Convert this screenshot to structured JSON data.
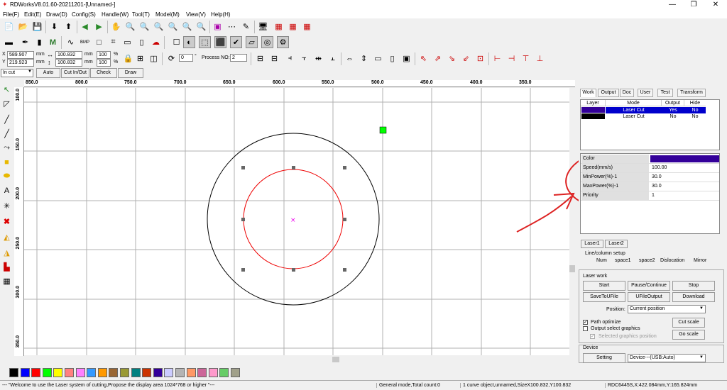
{
  "window": {
    "title": "RDWorksV8.01.60-20211201-[Unnamed-]",
    "minimize": "—",
    "maximize": "❐",
    "close": "✕"
  },
  "menu": [
    "File(F)",
    "Edit(E)",
    "Draw(D)",
    "Config(S)",
    "Handle(W)",
    "Tool(T)",
    "Model(M)",
    "View(V)",
    "Help(H)"
  ],
  "coords": {
    "x_label": "X",
    "y_label": "Y",
    "x_value": "589.907",
    "y_value": "219.923",
    "unit": "mm",
    "w_value": "100.832",
    "h_value": "100.832",
    "w_unit": "mm",
    "h_unit": "mm",
    "scale_w": "100",
    "scale_h": "100",
    "pct": "%",
    "rotate_value": "0",
    "rotate_unit": "°",
    "process_label": "Process NO:",
    "process_value": "2"
  },
  "cut_toolbar": {
    "mode_value": "In cut",
    "auto": "Auto",
    "cut_in_out": "Cut In/Out",
    "check": "Check",
    "draw": "Draw"
  },
  "ruler_top": [
    "850.0",
    "800.0",
    "750.0",
    "700.0",
    "650.0",
    "600.0",
    "550.0",
    "500.0",
    "450.0",
    "400.0",
    "350.0"
  ],
  "ruler_left": [
    "100.0",
    "150.0",
    "200.0",
    "250.0",
    "300.0",
    "350.0"
  ],
  "palette_colors": [
    "#000000",
    "#0000ff",
    "#ff0000",
    "#00ff00",
    "#ffff00",
    "#ff8080",
    "#ff80ff",
    "#3399ff",
    "#ff9900",
    "#996633",
    "#999933",
    "#008080",
    "#cc3300",
    "#330099",
    "#ccccff",
    "#b4b4b4",
    "#ff9966",
    "#cc6699",
    "#ff99cc",
    "#66cc66",
    "#a0a08a"
  ],
  "tabs": [
    "Work",
    "Output",
    "Doc",
    "User",
    "Test",
    "Transform"
  ],
  "layer_table": {
    "headers": [
      "Layer",
      "Mode",
      "Output",
      "Hide"
    ],
    "rows": [
      {
        "color": "#330099",
        "mode": "Laser Cut",
        "output": "Yes",
        "hide": "No",
        "selected": true
      },
      {
        "color": "#000000",
        "mode": "Laser Cut",
        "output": "No",
        "hide": "No",
        "selected": false
      }
    ]
  },
  "properties": [
    {
      "key": "Color",
      "value": ""
    },
    {
      "key": "Speed(mm/s)",
      "value": "100.00"
    },
    {
      "key": "MinPower(%)-1",
      "value": "30.0"
    },
    {
      "key": "MaxPower(%)-1",
      "value": "30.0"
    },
    {
      "key": "Priority",
      "value": "1"
    }
  ],
  "property_color": "#330099",
  "laser_tabs": [
    "Laser1",
    "Laser2"
  ],
  "line_column": {
    "title": "Line/column setup",
    "cols": [
      "Num",
      "space1",
      "space2",
      "Dislocation",
      "Mirror"
    ]
  },
  "laser_work": {
    "title": "Laser work",
    "start": "Start",
    "pause": "Pause/Continue",
    "stop": "Stop",
    "save_u": "SaveToUFile",
    "ufile_output": "UFileOutput",
    "download": "Download",
    "position_label": "Position:",
    "position_value": "Current position",
    "path_optimize": "Path optimize",
    "output_select": "Output select graphics",
    "selected_graphics": "Selected graphics position",
    "cut_scale": "Cut scale",
    "go_scale": "Go scale"
  },
  "device": {
    "title": "Device",
    "setting": "Setting",
    "device_value": "Device---(USB:Auto)"
  },
  "status": {
    "welcome": "--- \"Welcome to use the Laser system of cutting,Propose the display area 1024*768 or higher \"---",
    "mode": "General mode,Total count:0",
    "object": "1 curve object,unnamed,SizeX100.832,Y100.832",
    "coords": "RDC6445S,X:422.084mm,Y:165.824mm"
  }
}
